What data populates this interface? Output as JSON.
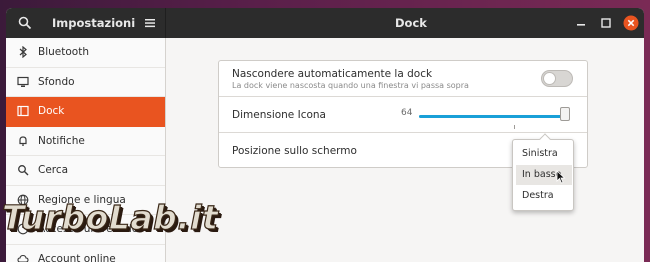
{
  "header": {
    "sidebar_title": "Impostazioni",
    "main_title": "Dock",
    "icons": [
      "search-icon",
      "menu-icon",
      "minimize-icon",
      "maximize-icon",
      "close-icon"
    ],
    "close_color": "#e95420"
  },
  "sidebar": {
    "items": [
      {
        "label": "Bluetooth",
        "icon": "bluetooth-icon"
      },
      {
        "label": "Sfondo",
        "icon": "display-icon"
      },
      {
        "label": "Dock",
        "icon": "dock-icon",
        "active": true
      },
      {
        "label": "Notifiche",
        "icon": "bell-icon"
      },
      {
        "label": "Cerca",
        "icon": "search-icon"
      },
      {
        "label": "Regione e lingua",
        "icon": "globe-icon"
      },
      {
        "label": "Accesso universale",
        "icon": "accessibility-icon"
      },
      {
        "label": "Account online",
        "icon": "cloud-icon"
      }
    ],
    "accent": "#e95420"
  },
  "settings": {
    "autohide": {
      "title": "Nascondere automaticamente la dock",
      "subtitle": "La dock viene nascosta quando una finestra vi passa sopra",
      "enabled": false
    },
    "icon_size": {
      "title": "Dimensione Icona",
      "value": "64",
      "level": 1.0
    },
    "position": {
      "title": "Posizione sullo schermo",
      "options": [
        "Sinistra",
        "In basso",
        "Destra"
      ],
      "selected": "In basso"
    }
  },
  "watermark": {
    "text": "TurboLab.it"
  }
}
